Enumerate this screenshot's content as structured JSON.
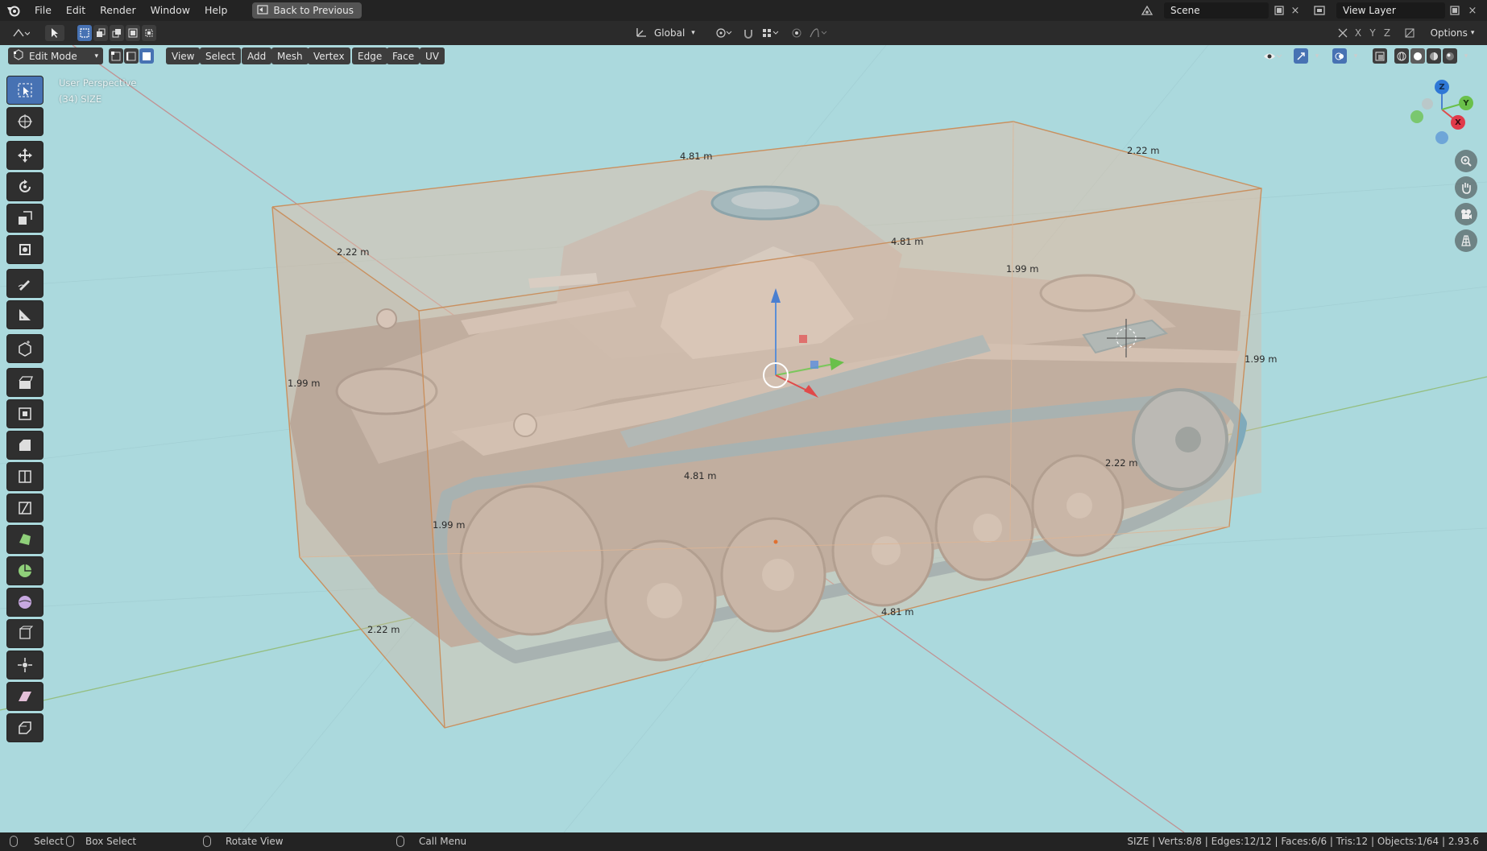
{
  "topbar": {
    "menus": [
      "File",
      "Edit",
      "Render",
      "Window",
      "Help"
    ],
    "back_button": "Back to Previous",
    "scene_label": "Scene",
    "view_layer_label": "View Layer"
  },
  "header2": {
    "transform_orientation": "Global",
    "axis_labels": [
      "X",
      "Y",
      "Z"
    ],
    "options_label": "Options"
  },
  "viewport_header": {
    "mode": "Edit Mode",
    "menus": [
      "View",
      "Select",
      "Add",
      "Mesh",
      "Vertex",
      "Edge",
      "Face",
      "UV"
    ]
  },
  "viewport": {
    "perspective_label": "User Perspective",
    "object_label": "(34) SIZE",
    "gizmo_axes": [
      "Z",
      "Y",
      "X"
    ],
    "dimension_labels": {
      "top_length": "4.81 m",
      "top_right_width": "2.22 m",
      "left_width": "2.22 m",
      "top_mid_length": "4.81 m",
      "mid_right_height": "1.99 m",
      "far_right_height": "1.99 m",
      "left_height": "1.99 m",
      "mid_length": "4.81 m",
      "right_width": "2.22 m",
      "front_height": "1.99 m",
      "bottom_width": "2.22 m",
      "bottom_length": "4.81 m"
    }
  },
  "statusbar": {
    "select": "Select",
    "box_select": "Box Select",
    "rotate_view": "Rotate View",
    "call_menu": "Call Menu",
    "stats": "SIZE | Verts:8/8 | Edges:12/12 | Faces:6/6 | Tris:12 | Objects:1/64 | 2.93.6"
  },
  "colors": {
    "viewport_bg": "#abd9dd",
    "active_blue": "#4772b3",
    "box_fill": "#d9b49a",
    "box_edge": "#e08a3c",
    "tank_body": "#b3aca5",
    "tank_track": "#7faabb"
  }
}
